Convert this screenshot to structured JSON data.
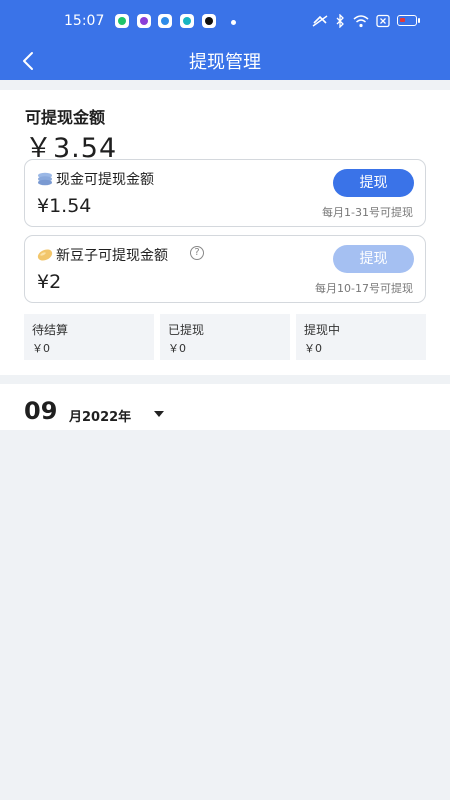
{
  "status_bar": {
    "time": "15:07",
    "notification_icons": [
      "green-app-icon",
      "purple-app-icon",
      "blue-app-icon",
      "teal-app-icon",
      "black-app-icon"
    ],
    "system_icons": [
      "mute-icon",
      "bluetooth-icon",
      "wifi-icon",
      "sim-icon",
      "battery-icon"
    ]
  },
  "header": {
    "title": "提现管理",
    "back_icon": "chevron-left-icon"
  },
  "balance": {
    "label": "可提现金额",
    "amount": "￥3.54"
  },
  "cash": {
    "title": "现金可提现金额",
    "amount": "¥1.54",
    "button_label": "提现",
    "note": "每月1-31号可提现",
    "icon": "coin-stack-icon"
  },
  "beans": {
    "title": "新豆子可提现金额",
    "help_icon": "?",
    "amount": "¥2",
    "button_label": "提现",
    "note": "每月10-17号可提现",
    "icon": "bean-icon"
  },
  "stats": [
    {
      "label": "待结算",
      "value": "￥0"
    },
    {
      "label": "已提现",
      "value": "￥0"
    },
    {
      "label": "提现中",
      "value": "￥0"
    }
  ],
  "filter": {
    "month": "09",
    "suffix": "月2022年",
    "icon": "caret-down-icon"
  },
  "colors": {
    "primary": "#3a73e8",
    "button_disabled": "#a5c0f2",
    "background": "#eff2f5"
  }
}
